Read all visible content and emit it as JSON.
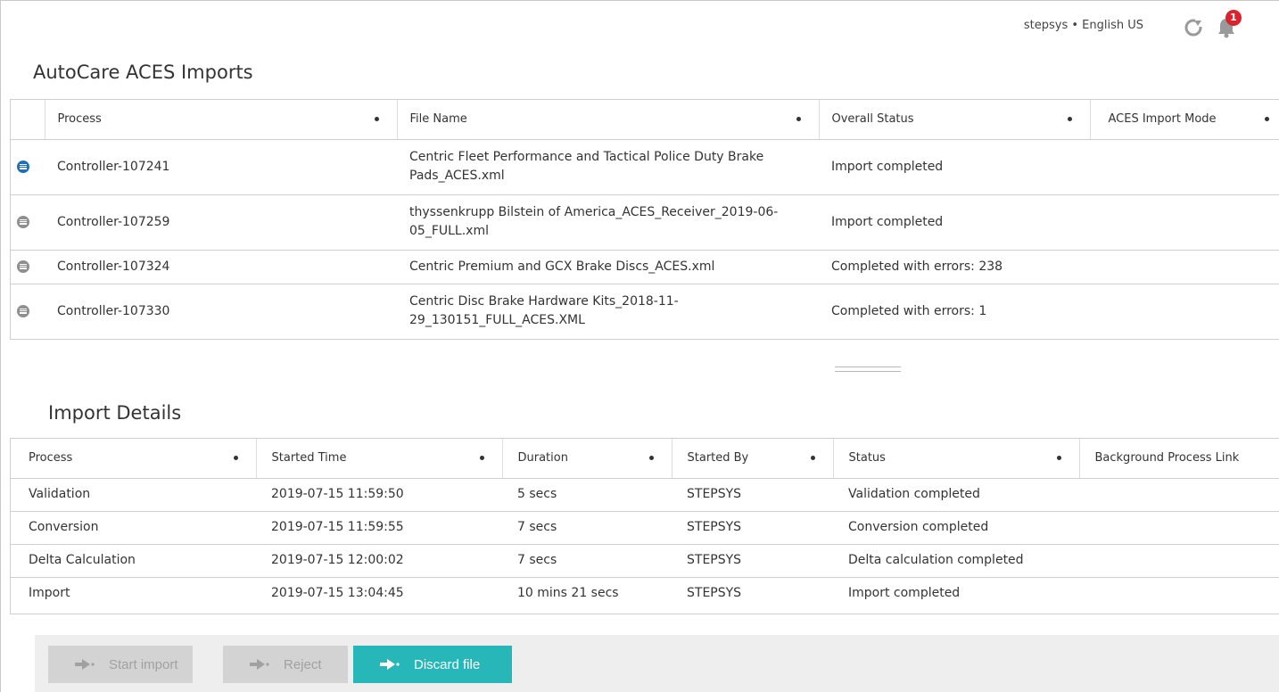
{
  "header": {
    "user_lang": "stepsys • English US",
    "notification_count": "1"
  },
  "imports": {
    "title": "AutoCare ACES Imports",
    "columns": [
      "Process",
      "File Name",
      "Overall Status",
      "ACES Import Mode"
    ],
    "rows": [
      {
        "process": "Controller-107241",
        "file": "Centric Fleet Performance and Tactical Police Duty Brake Pads_ACES.xml",
        "status": "Import completed",
        "mode": "",
        "selected": true
      },
      {
        "process": "Controller-107259",
        "file": "thyssenkrupp Bilstein of America_ACES_Receiver_2019-06-05_FULL.xml",
        "status": "Import completed",
        "mode": "",
        "selected": false
      },
      {
        "process": "Controller-107324",
        "file": "Centric Premium and GCX Brake Discs_ACES.xml",
        "status": "Completed with errors: 238",
        "mode": "",
        "selected": false
      },
      {
        "process": "Controller-107330",
        "file": "Centric Disc Brake Hardware Kits_2018-11-29_130151_FULL_ACES.XML",
        "status": "Completed with errors: 1",
        "mode": "",
        "selected": false
      }
    ]
  },
  "details": {
    "title": "Import Details",
    "columns": [
      "Process",
      "Started Time",
      "Duration",
      "Started By",
      "Status",
      "Background Process Link"
    ],
    "rows": [
      {
        "process": "Validation",
        "started": "2019-07-15 11:59:50",
        "duration": "5 secs",
        "by": "STEPSYS",
        "status": "Validation completed",
        "link": ""
      },
      {
        "process": "Conversion",
        "started": "2019-07-15 11:59:55",
        "duration": "7 secs",
        "by": "STEPSYS",
        "status": "Conversion completed",
        "link": ""
      },
      {
        "process": "Delta Calculation",
        "started": "2019-07-15 12:00:02",
        "duration": "7 secs",
        "by": "STEPSYS",
        "status": "Delta calculation completed",
        "link": ""
      },
      {
        "process": "Import",
        "started": "2019-07-15 13:04:45",
        "duration": "10 mins 21 secs",
        "by": "STEPSYS",
        "status": "Import completed",
        "link": ""
      }
    ]
  },
  "footer": {
    "start_import": "Start import",
    "reject": "Reject",
    "discard_file": "Discard file"
  },
  "colors": {
    "accent": "#27b7b8",
    "selected_icon": "#1f6fb8",
    "badge": "#d9232e"
  }
}
